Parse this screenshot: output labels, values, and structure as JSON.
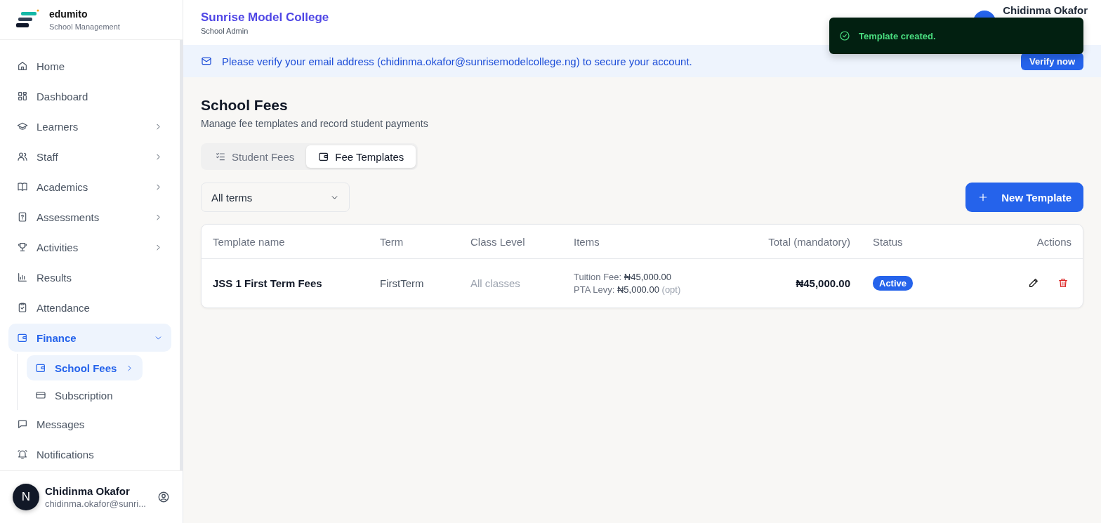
{
  "brand": {
    "name": "edumito",
    "subtitle": "School Management"
  },
  "sidebar": {
    "items": [
      {
        "label": "Home",
        "has_arrow": false,
        "selected": false
      },
      {
        "label": "Dashboard",
        "has_arrow": false,
        "selected": false
      },
      {
        "label": "Learners",
        "has_arrow": true,
        "selected": false
      },
      {
        "label": "Staff",
        "has_arrow": true,
        "selected": false
      },
      {
        "label": "Academics",
        "has_arrow": true,
        "selected": false
      },
      {
        "label": "Assessments",
        "has_arrow": true,
        "selected": false
      },
      {
        "label": "Activities",
        "has_arrow": true,
        "selected": false
      },
      {
        "label": "Results",
        "has_arrow": false,
        "selected": false
      },
      {
        "label": "Attendance",
        "has_arrow": false,
        "selected": false
      },
      {
        "label": "Finance",
        "has_arrow": true,
        "selected": true,
        "expanded": true,
        "children": [
          {
            "label": "School Fees",
            "has_arrow": true,
            "selected": true
          },
          {
            "label": "Subscription",
            "has_arrow": false,
            "selected": false
          }
        ]
      },
      {
        "label": "Messages",
        "has_arrow": false,
        "selected": false
      },
      {
        "label": "Notifications",
        "has_arrow": false,
        "selected": false
      }
    ],
    "user": {
      "initial": "N",
      "name": "Chidinma Okafor",
      "email": "chidinma.okafor@sunri..."
    }
  },
  "header": {
    "school": "Sunrise Model College",
    "role": "School Admin",
    "user_name": "Chidinma Okafor"
  },
  "toast": {
    "message": "Template created."
  },
  "banner": {
    "message": "Please verify your email address (chidinma.okafor@sunrisemodelcollege.ng) to secure your account.",
    "button": "Verify now"
  },
  "page": {
    "title": "School Fees",
    "subtitle": "Manage fee templates and record student payments"
  },
  "tabs": [
    {
      "label": "Student Fees",
      "selected": false
    },
    {
      "label": "Fee Templates",
      "selected": true
    }
  ],
  "filter": {
    "value": "All terms"
  },
  "new_button": "New Template",
  "table": {
    "columns": [
      "Template name",
      "Term",
      "Class Level",
      "Items",
      "Total (mandatory)",
      "Status",
      "Actions"
    ],
    "rows": [
      {
        "name": "JSS 1 First Term Fees",
        "term": "FirstTerm",
        "class_level": "All classes",
        "items": [
          {
            "label": "Tuition Fee:",
            "amount": "₦45,000.00"
          },
          {
            "label": "PTA Levy:",
            "amount": "₦5,000.00",
            "note": "(opt)"
          }
        ],
        "total": "₦45,000.00",
        "status": "Active"
      }
    ]
  }
}
